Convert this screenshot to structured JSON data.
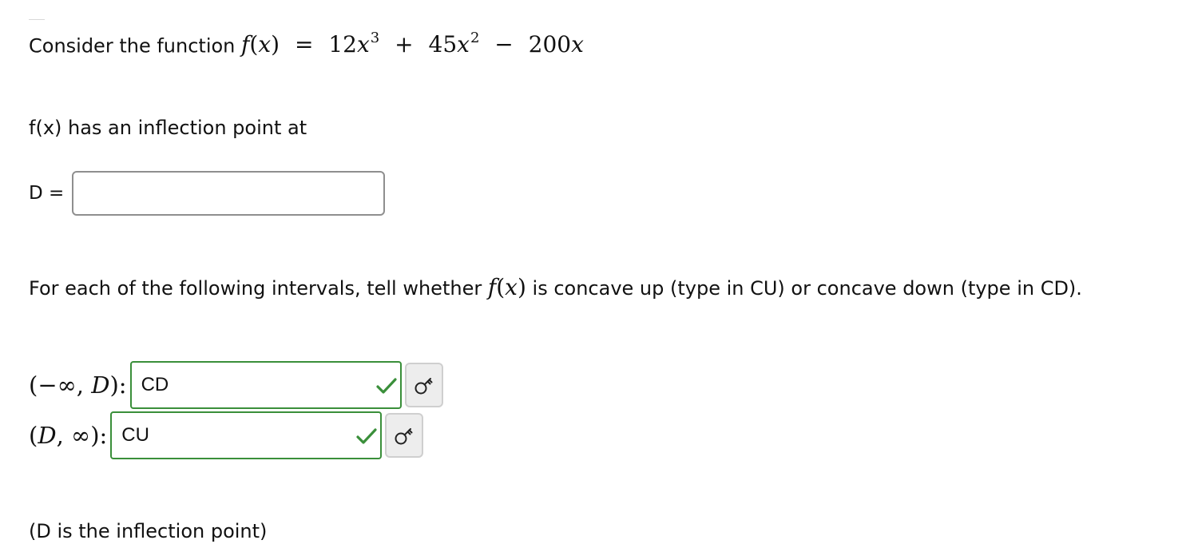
{
  "problem": {
    "intro_text": "Consider the function",
    "function_name": "f",
    "variable": "x",
    "coeff_a": "12",
    "exp_a": "3",
    "coeff_b": "45",
    "exp_b": "2",
    "coeff_c": "200"
  },
  "inflection": {
    "text": "f(x) has an inflection point at"
  },
  "d_field": {
    "label": "D =",
    "value": ""
  },
  "intervals": {
    "prompt_before": "For each of the following intervals, tell whether",
    "prompt_after": "is concave up (type in CU) or concave down (type in CD).",
    "rows": [
      {
        "label_prefix": "(−∞, ",
        "label_var": "D",
        "label_suffix": "):",
        "answer": "CD",
        "status": "correct"
      },
      {
        "label_prefix": "(",
        "label_var": "D",
        "label_suffix": ", ∞):",
        "answer": "CU",
        "status": "correct"
      }
    ]
  },
  "footer": {
    "note": "(D is the inflection point)"
  },
  "colors": {
    "correct_border": "#3a8f3a",
    "check_mark": "#3a8f3a",
    "key_button_bg": "#ededed"
  },
  "icons": {
    "correct": "check-icon",
    "answer_key": "key-icon"
  }
}
